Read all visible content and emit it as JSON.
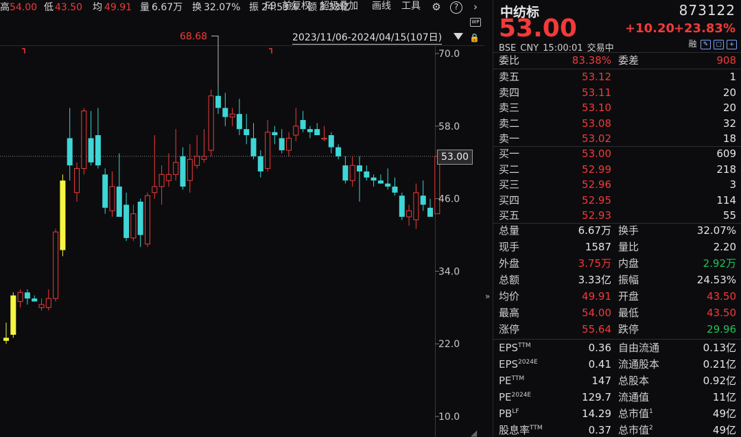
{
  "toolbar": {
    "high_label": "高",
    "high_value": "54.00",
    "low_label": "低",
    "low_value": "43.50",
    "avg_label": "均",
    "avg_value": "49.91",
    "vol_label": "量",
    "vol_value": "6.67万",
    "turnover_label": "换",
    "turnover_value": "32.07%",
    "amp_label": "振",
    "amp_value": "24.53%",
    "amount_label": "额",
    "amount_value": "3.33亿",
    "buttons": [
      "F9",
      "前复权",
      "超级叠加",
      "画线",
      "工具"
    ],
    "icons": [
      "gear-icon",
      "help-icon",
      "chevron-right-icon"
    ],
    "wp_badge": "WP"
  },
  "chart": {
    "date_range": "2023/11/06-2024/04/15(107日)",
    "max_marker": "68.68",
    "current_price_tag": "53.00",
    "y_ticks": [
      "70.0",
      "58.0",
      "46.0",
      "34.0",
      "22.0",
      "10.0"
    ],
    "y_tick_values": [
      70,
      58,
      46,
      34,
      22,
      10
    ],
    "up_color": "#f23a3a",
    "down_color": "#3ed6d6",
    "limit_up_color": "#f5f542",
    "candles": [
      {
        "o": 22.5,
        "h": 25.5,
        "l": 22.0,
        "c": 23.0,
        "lim": true
      },
      {
        "o": 23.5,
        "h": 30.5,
        "l": 23.0,
        "c": 30.0,
        "lim": true
      },
      {
        "o": 29.0,
        "h": 31.0,
        "l": 28.0,
        "c": 30.5
      },
      {
        "o": 30.5,
        "h": 31.0,
        "l": 28.5,
        "c": 29.5
      },
      {
        "o": 29.5,
        "h": 30.0,
        "l": 29.0,
        "c": 29.0
      },
      {
        "o": 28.0,
        "h": 29.5,
        "l": 27.5,
        "c": 28.5
      },
      {
        "o": 28.0,
        "h": 31.0,
        "l": 27.5,
        "c": 29.5
      },
      {
        "o": 29.5,
        "h": 41.0,
        "l": 29.0,
        "c": 40.5
      },
      {
        "o": 37.5,
        "h": 50.0,
        "l": 36.5,
        "c": 49.0,
        "lim": true
      },
      {
        "o": 56.0,
        "h": 61.0,
        "l": 49.0,
        "c": 51.5
      },
      {
        "o": 47.0,
        "h": 52.0,
        "l": 45.5,
        "c": 51.0
      },
      {
        "o": 51.0,
        "h": 61.0,
        "l": 50.0,
        "c": 60.5
      },
      {
        "o": 56.0,
        "h": 60.5,
        "l": 51.5,
        "c": 52.0
      },
      {
        "o": 56.5,
        "h": 61.0,
        "l": 51.0,
        "c": 51.5
      },
      {
        "o": 50.0,
        "h": 51.0,
        "l": 43.5,
        "c": 44.5
      },
      {
        "o": 44.0,
        "h": 50.5,
        "l": 43.0,
        "c": 48.0
      },
      {
        "o": 48.0,
        "h": 53.5,
        "l": 43.0,
        "c": 43.0
      },
      {
        "o": 45.0,
        "h": 47.0,
        "l": 39.0,
        "c": 39.5
      },
      {
        "o": 39.5,
        "h": 45.0,
        "l": 39.0,
        "c": 43.5
      },
      {
        "o": 45.5,
        "h": 46.0,
        "l": 38.0,
        "c": 40.0
      },
      {
        "o": 38.5,
        "h": 47.0,
        "l": 38.0,
        "c": 46.5
      },
      {
        "o": 47.0,
        "h": 56.5,
        "l": 46.0,
        "c": 48.0
      },
      {
        "o": 48.0,
        "h": 51.5,
        "l": 45.0,
        "c": 50.0
      },
      {
        "o": 49.0,
        "h": 53.5,
        "l": 48.0,
        "c": 50.0
      },
      {
        "o": 50.0,
        "h": 57.5,
        "l": 49.0,
        "c": 52.0
      },
      {
        "o": 53.0,
        "h": 54.5,
        "l": 47.5,
        "c": 48.0
      },
      {
        "o": 49.0,
        "h": 55.0,
        "l": 47.0,
        "c": 52.5
      },
      {
        "o": 51.5,
        "h": 56.5,
        "l": 51.0,
        "c": 53.0
      },
      {
        "o": 52.5,
        "h": 57.5,
        "l": 52.0,
        "c": 53.0
      },
      {
        "o": 54.0,
        "h": 64.0,
        "l": 53.0,
        "c": 63.0
      },
      {
        "o": 63.0,
        "h": 68.7,
        "l": 60.0,
        "c": 61.0
      },
      {
        "o": 61.0,
        "h": 63.5,
        "l": 58.0,
        "c": 59.5
      },
      {
        "o": 59.5,
        "h": 61.0,
        "l": 58.0,
        "c": 60.0
      },
      {
        "o": 60.0,
        "h": 62.5,
        "l": 56.5,
        "c": 57.5
      },
      {
        "o": 57.5,
        "h": 60.0,
        "l": 55.0,
        "c": 56.5
      },
      {
        "o": 56.0,
        "h": 58.5,
        "l": 52.5,
        "c": 53.0
      },
      {
        "o": 53.0,
        "h": 54.0,
        "l": 49.5,
        "c": 50.5
      },
      {
        "o": 51.0,
        "h": 59.0,
        "l": 50.5,
        "c": 57.0
      },
      {
        "o": 57.0,
        "h": 58.0,
        "l": 55.0,
        "c": 56.5
      },
      {
        "o": 56.0,
        "h": 57.5,
        "l": 53.5,
        "c": 54.0
      },
      {
        "o": 54.0,
        "h": 57.0,
        "l": 53.0,
        "c": 56.0
      },
      {
        "o": 56.5,
        "h": 61.0,
        "l": 55.5,
        "c": 58.0
      },
      {
        "o": 59.0,
        "h": 60.5,
        "l": 57.0,
        "c": 57.5
      },
      {
        "o": 57.5,
        "h": 58.0,
        "l": 56.0,
        "c": 57.0
      },
      {
        "o": 57.5,
        "h": 58.5,
        "l": 56.5,
        "c": 56.5
      },
      {
        "o": 56.0,
        "h": 58.0,
        "l": 55.5,
        "c": 56.0
      },
      {
        "o": 56.5,
        "h": 57.0,
        "l": 53.5,
        "c": 54.5
      },
      {
        "o": 54.5,
        "h": 55.0,
        "l": 52.5,
        "c": 53.0
      },
      {
        "o": 51.5,
        "h": 53.0,
        "l": 48.5,
        "c": 49.0
      },
      {
        "o": 49.0,
        "h": 53.0,
        "l": 48.0,
        "c": 51.5
      },
      {
        "o": 51.5,
        "h": 53.0,
        "l": 45.5,
        "c": 50.5
      },
      {
        "o": 50.5,
        "h": 51.5,
        "l": 49.0,
        "c": 49.5
      },
      {
        "o": 49.5,
        "h": 50.0,
        "l": 48.0,
        "c": 49.0
      },
      {
        "o": 49.0,
        "h": 50.0,
        "l": 48.5,
        "c": 48.5
      },
      {
        "o": 48.5,
        "h": 51.0,
        "l": 47.5,
        "c": 48.0
      },
      {
        "o": 48.0,
        "h": 49.5,
        "l": 46.5,
        "c": 47.0
      },
      {
        "o": 46.5,
        "h": 47.0,
        "l": 42.5,
        "c": 43.0
      },
      {
        "o": 43.0,
        "h": 45.0,
        "l": 41.5,
        "c": 44.0
      },
      {
        "o": 42.5,
        "h": 48.5,
        "l": 41.0,
        "c": 47.0
      },
      {
        "o": 46.5,
        "h": 49.0,
        "l": 44.0,
        "c": 45.0
      },
      {
        "o": 44.5,
        "h": 46.0,
        "l": 43.0,
        "c": 43.0
      },
      {
        "o": 43.5,
        "h": 54.0,
        "l": 43.5,
        "c": 53.0
      }
    ]
  },
  "panel": {
    "name": "中纺标",
    "code": "873122",
    "price": "53.00",
    "change": "+10.20",
    "change_pct": "+23.83%",
    "sub_info": "BSE  CNY  15:00:01  交易中",
    "flags": [
      "融",
      "edit-icon",
      "window-icon",
      "add-icon"
    ],
    "weibi_label": "委比",
    "weibi_value": "83.38%",
    "weicha_label": "委差",
    "weicha_value": "908",
    "asks": [
      {
        "label": "卖五",
        "price": "53.12",
        "vol": "1"
      },
      {
        "label": "卖四",
        "price": "53.11",
        "vol": "20"
      },
      {
        "label": "卖三",
        "price": "53.10",
        "vol": "20"
      },
      {
        "label": "卖二",
        "price": "53.08",
        "vol": "32"
      },
      {
        "label": "卖一",
        "price": "53.02",
        "vol": "18"
      }
    ],
    "bids": [
      {
        "label": "买一",
        "price": "53.00",
        "vol": "609"
      },
      {
        "label": "买二",
        "price": "52.99",
        "vol": "218"
      },
      {
        "label": "买三",
        "price": "52.96",
        "vol": "3"
      },
      {
        "label": "买四",
        "price": "52.95",
        "vol": "114"
      },
      {
        "label": "买五",
        "price": "52.93",
        "vol": "55"
      }
    ],
    "stats": [
      {
        "l1": "总量",
        "v1": "6.67万",
        "c1": "white",
        "l2": "换手",
        "v2": "32.07%",
        "c2": "white"
      },
      {
        "l1": "现手",
        "v1": "1587",
        "c1": "white",
        "l2": "量比",
        "v2": "2.20",
        "c2": "white"
      },
      {
        "l1": "外盘",
        "v1": "3.75万",
        "c1": "red",
        "l2": "内盘",
        "v2": "2.92万",
        "c2": "green"
      },
      {
        "l1": "总额",
        "v1": "3.33亿",
        "c1": "white",
        "l2": "振幅",
        "v2": "24.53%",
        "c2": "white"
      },
      {
        "l1": "均价",
        "v1": "49.91",
        "c1": "red",
        "l2": "开盘",
        "v2": "43.50",
        "c2": "red"
      },
      {
        "l1": "最高",
        "v1": "54.00",
        "c1": "red",
        "l2": "最低",
        "v2": "43.50",
        "c2": "red"
      },
      {
        "l1": "涨停",
        "v1": "55.64",
        "c1": "red",
        "l2": "跌停",
        "v2": "29.96",
        "c2": "green"
      }
    ],
    "finance": [
      {
        "l1": "EPS",
        "s1": "TTM",
        "v1": "0.36",
        "l2": "自由流通",
        "s2": "",
        "v2": "0.13亿"
      },
      {
        "l1": "EPS",
        "s1": "2024E",
        "v1": "0.41",
        "l2": "流通股本",
        "s2": "",
        "v2": "0.21亿"
      },
      {
        "l1": "PE",
        "s1": "TTM",
        "v1": "147",
        "l2": "总股本",
        "s2": "",
        "v2": "0.92亿"
      },
      {
        "l1": "PE",
        "s1": "2024E",
        "v1": "129.7",
        "l2": "流通值",
        "s2": "",
        "v2": "11亿"
      },
      {
        "l1": "PB",
        "s1": "LF",
        "v1": "14.29",
        "l2": "总市值",
        "s2": "1",
        "v2": "49亿"
      },
      {
        "l1": "股息率",
        "s1": "TTM",
        "v1": "0.37",
        "l2": "总市值",
        "s2": "2",
        "v2": "49亿"
      }
    ]
  }
}
